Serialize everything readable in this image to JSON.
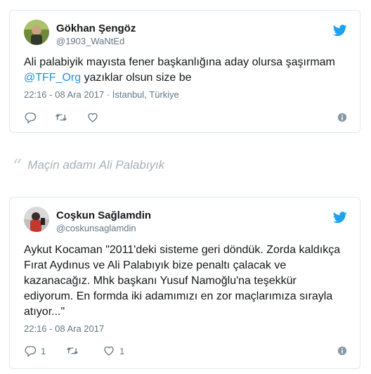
{
  "tweets": [
    {
      "name": "Gökhan Şengöz",
      "handle": "@1903_WaNtEd",
      "text_before": "Ali palabiyik mayısta fener başkanlığına aday olursa şaşırmam",
      "mention": "@TFF_Org",
      "text_after": " yazıklar olsun size be",
      "timestamp": "22:16 - 08 Ara 2017",
      "location": " · İstanbul, Türkiye",
      "reply_count": "",
      "retweet_count": "",
      "like_count": ""
    },
    {
      "name": "Coşkun Sağlamdin",
      "handle": "@coskunsaglamdin",
      "text": "Aykut Kocaman \"2011'deki sisteme geri döndük. Zorda kaldıkça Fırat Aydınus ve Ali Palabıyık bize penaltı çalacak ve kazanacağız. Mhk başkanı Yusuf Namoğlu'na teşekkür ediyorum. En formda iki adamımızı en zor maçlarımıza sırayla atıyor...\"",
      "timestamp": "22:16 - 08 Ara 2017",
      "reply_count": "1",
      "retweet_count": "",
      "like_count": "1"
    }
  ],
  "quote": {
    "mark": "“",
    "text": "Maçin adamı Ali Palabıyık"
  },
  "colors": {
    "link": "#1b95e0",
    "twitter_blue": "#1da1f2",
    "secondary_text": "#657786",
    "border": "#e1e8ed"
  },
  "icons": [
    "twitter-bird-icon",
    "reply-icon",
    "retweet-icon",
    "like-icon",
    "info-icon"
  ]
}
